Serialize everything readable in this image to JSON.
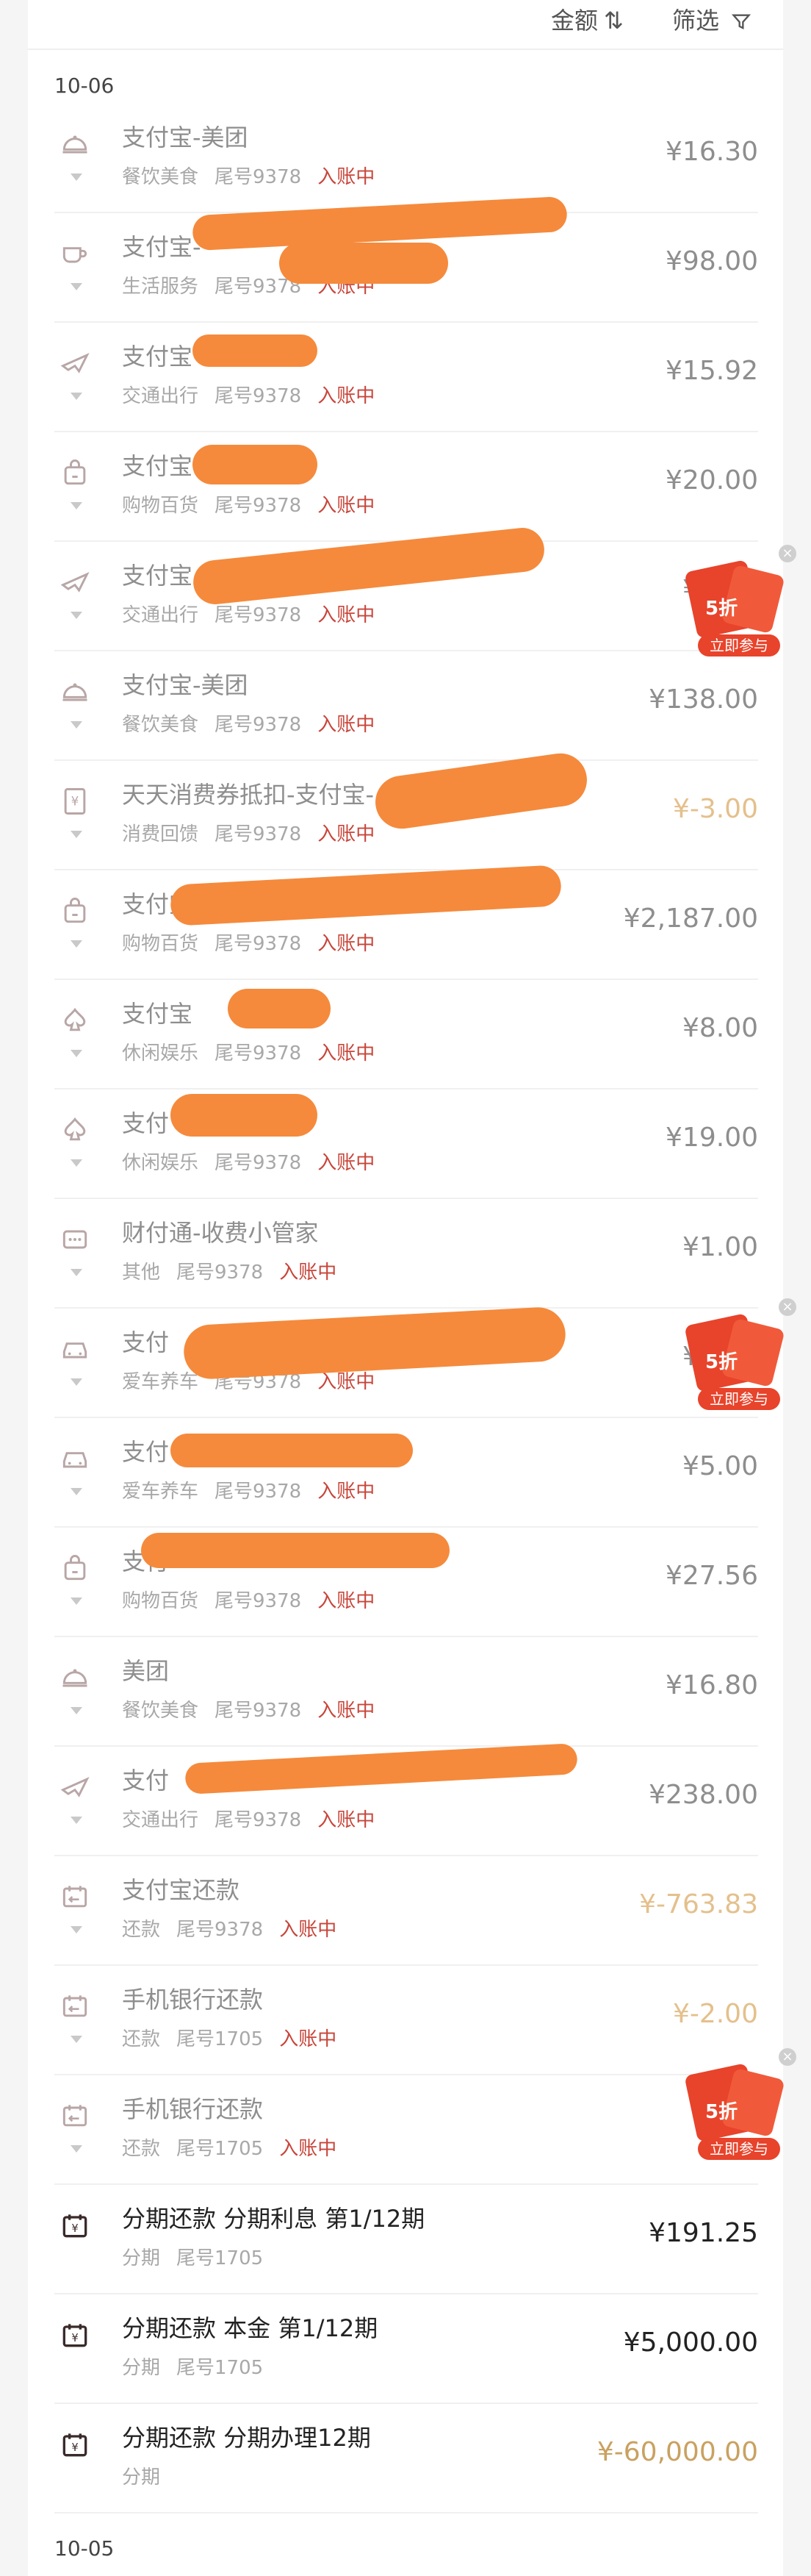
{
  "header": {
    "sort_label": "金额",
    "sort_glyph": "⇅",
    "filter_label": "筛选"
  },
  "date_groups": [
    {
      "date": "10-06"
    },
    {
      "date": "10-05"
    }
  ],
  "transactions": [
    {
      "title": "支付宝-美团",
      "category": "餐饮美食",
      "card": "尾号9378",
      "status": "入账中",
      "amount": "¥16.30",
      "icon": "food-icon"
    },
    {
      "title": "支付宝-",
      "category": "生活服务",
      "card": "尾号9378",
      "status": "入账中",
      "amount": "¥98.00",
      "icon": "coffee-icon"
    },
    {
      "title": "支付宝",
      "category": "交通出行",
      "card": "尾号9378",
      "status": "入账中",
      "amount": "¥15.92",
      "icon": "plane-icon"
    },
    {
      "title": "支付宝",
      "category": "购物百货",
      "card": "尾号9378",
      "status": "入账中",
      "amount": "¥20.00",
      "icon": "shopping-bag-icon"
    },
    {
      "title": "支付宝",
      "category": "交通出行",
      "card": "尾号9378",
      "status": "入账中",
      "amount": "¥5.00",
      "icon": "plane-icon"
    },
    {
      "title": "支付宝-美团",
      "category": "餐饮美食",
      "card": "尾号9378",
      "status": "入账中",
      "amount": "¥138.00",
      "icon": "food-icon"
    },
    {
      "title": "天天消费券抵扣-支付宝-",
      "category": "消费回馈",
      "card": "尾号9378",
      "status": "入账中",
      "amount": "¥-3.00",
      "icon": "voucher-icon"
    },
    {
      "title": "支付宝",
      "category": "购物百货",
      "card": "尾号9378",
      "status": "入账中",
      "amount": "¥2,187.00",
      "icon": "shopping-bag-icon"
    },
    {
      "title": "支付宝",
      "category": "休闲娱乐",
      "card": "尾号9378",
      "status": "入账中",
      "amount": "¥8.00",
      "icon": "spade-icon"
    },
    {
      "title": "支付",
      "category": "休闲娱乐",
      "card": "尾号9378",
      "status": "入账中",
      "amount": "¥19.00",
      "icon": "spade-icon"
    },
    {
      "title": "财付通-收费小管家",
      "category": "其他",
      "card": "尾号9378",
      "status": "入账中",
      "amount": "¥1.00",
      "icon": "more-icon"
    },
    {
      "title": "支付",
      "category": "爱车养车",
      "card": "尾号9378",
      "status": "入账中",
      "amount": "¥5.00",
      "icon": "car-icon"
    },
    {
      "title": "支付",
      "category": "爱车养车",
      "card": "尾号9378",
      "status": "入账中",
      "amount": "¥5.00",
      "icon": "car-icon"
    },
    {
      "title": "支付",
      "category": "购物百货",
      "card": "尾号9378",
      "status": "入账中",
      "amount": "¥27.56",
      "icon": "shopping-bag-icon"
    },
    {
      "title": "美团",
      "category": "餐饮美食",
      "card": "尾号9378",
      "status": "入账中",
      "amount": "¥16.80",
      "icon": "food-icon"
    },
    {
      "title": "支付",
      "category": "交通出行",
      "card": "尾号9378",
      "status": "入账中",
      "amount": "¥238.00",
      "icon": "plane-icon"
    },
    {
      "title": "支付宝还款",
      "category": "还款",
      "card": "尾号9378",
      "status": "入账中",
      "amount": "¥-763.83",
      "icon": "repay-icon"
    },
    {
      "title": "手机银行还款",
      "category": "还款",
      "card": "尾号1705",
      "status": "入账中",
      "amount": "¥-2.00",
      "icon": "repay-icon"
    },
    {
      "title": "手机银行还款",
      "category": "还款",
      "card": "尾号1705",
      "status": "入账中",
      "amount": "¥-",
      "icon": "repay-icon"
    },
    {
      "title": "分期还款 分期利息 第1/12期",
      "category": "分期",
      "card": "尾号1705",
      "status": "",
      "amount": "¥191.25",
      "icon": "installment-icon"
    },
    {
      "title": "分期还款 本金 第1/12期",
      "category": "分期",
      "card": "尾号1705",
      "status": "",
      "amount": "¥5,000.00",
      "icon": "installment-icon"
    },
    {
      "title": "分期还款 分期办理12期",
      "category": "分期",
      "card": "",
      "status": "",
      "amount": "¥-60,000.00",
      "icon": "installment-icon"
    }
  ],
  "promo": {
    "discount": "5折",
    "cta": "立即参与",
    "close": "×"
  },
  "colors": {
    "status": "#c8453a",
    "refund": "#e4c08c",
    "accent_orange": "#f58a3c"
  }
}
